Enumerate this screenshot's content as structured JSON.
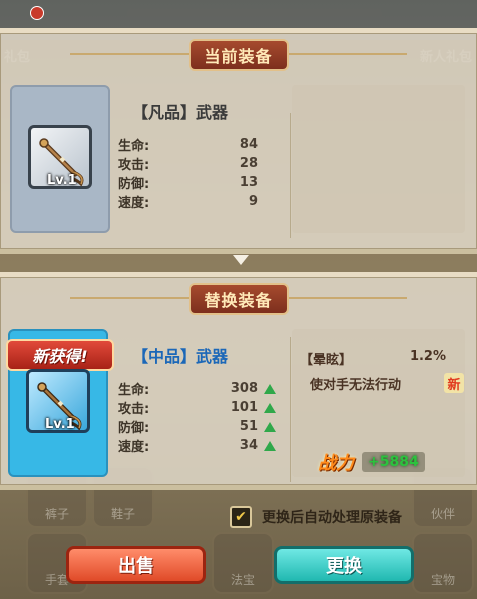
{
  "background": {
    "top_left_label": "礼包",
    "top_right_label": "新人礼包",
    "slot_labels": [
      "裤子",
      "鞋子",
      "手套",
      "法宝",
      "宝物",
      "伙伴"
    ]
  },
  "current_panel": {
    "banner": "当前装备",
    "item": {
      "title": "【凡品】武器",
      "level": "Lv.1",
      "stats": [
        {
          "label": "生命:",
          "value": "84"
        },
        {
          "label": "攻击:",
          "value": "28"
        },
        {
          "label": "防御:",
          "value": "13"
        },
        {
          "label": "速度:",
          "value": "9"
        }
      ]
    }
  },
  "replace_panel": {
    "banner": "替换装备",
    "new_badge": "新获得!",
    "item": {
      "title": "【中品】武器",
      "level": "Lv.1",
      "stats": [
        {
          "label": "生命:",
          "value": "308",
          "trend": "up"
        },
        {
          "label": "攻击:",
          "value": "101",
          "trend": "up"
        },
        {
          "label": "防御:",
          "value": "51",
          "trend": "up"
        },
        {
          "label": "速度:",
          "value": "34",
          "trend": "up"
        }
      ]
    },
    "skill": {
      "name": "【晕眩】",
      "rate": "1.2%",
      "description": "使对手无法行动",
      "new_tag": "新"
    },
    "power": {
      "label": "战力",
      "value": "+5884"
    }
  },
  "auto_process": {
    "checked": true,
    "label": "更换后自动处理原装备"
  },
  "buttons": {
    "sell": "出售",
    "replace": "更换"
  },
  "colors": {
    "up_arrow": "#2fa84a",
    "power_value": "#2cc23e",
    "replace_title": "#1b67b8",
    "sell_button": "#e04a28",
    "replace_button": "#20b8b0"
  }
}
